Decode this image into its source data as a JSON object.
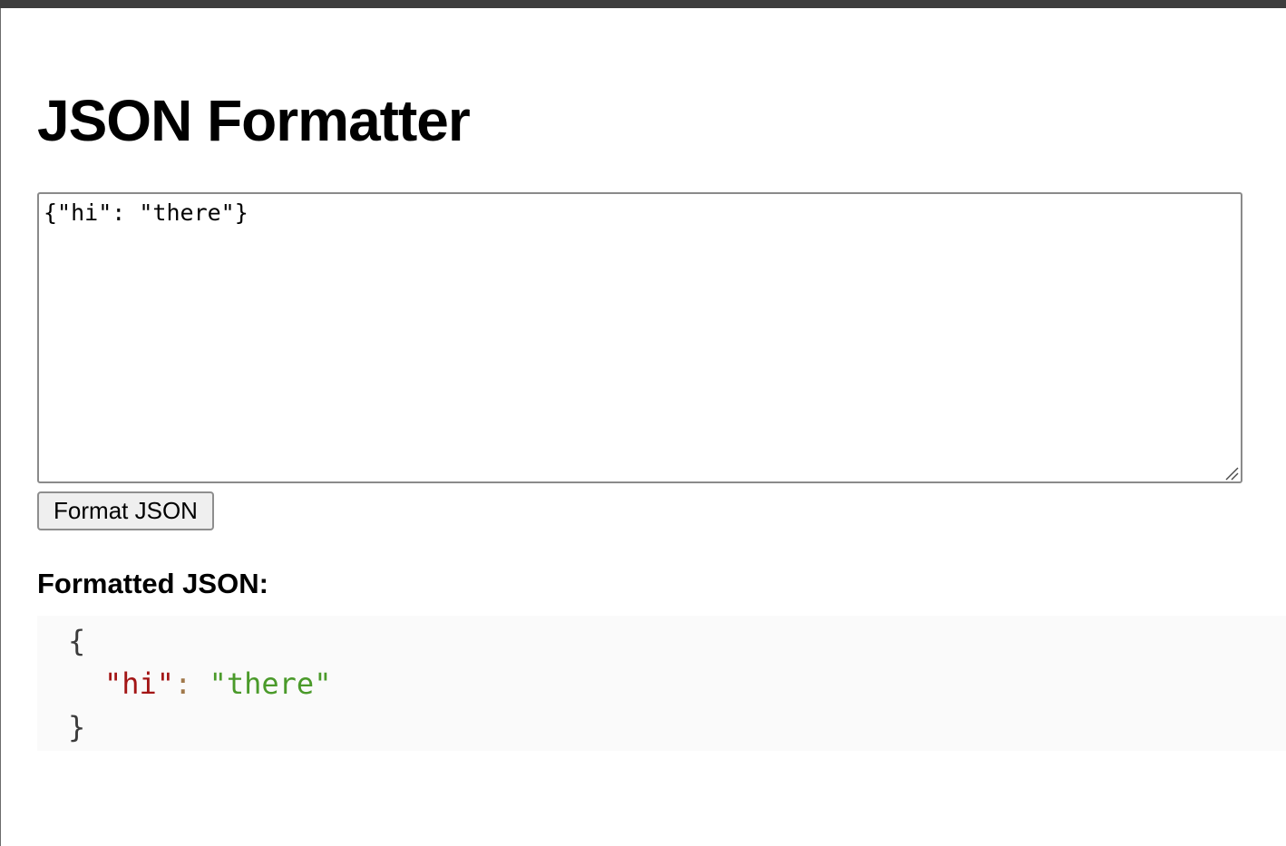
{
  "page": {
    "title": "JSON Formatter"
  },
  "input": {
    "value": "{\"hi\": \"there\"}"
  },
  "actions": {
    "format_label": "Format JSON"
  },
  "output": {
    "heading": "Formatted JSON:",
    "open_brace": "{",
    "entries": [
      {
        "key": "\"hi\"",
        "separator": ": ",
        "value": "\"there\""
      }
    ],
    "close_brace": "}"
  },
  "colors": {
    "key": "#a31515",
    "string_value": "#4a9a2a",
    "punctuation": "#a0784a",
    "output_background": "#fafafa"
  }
}
